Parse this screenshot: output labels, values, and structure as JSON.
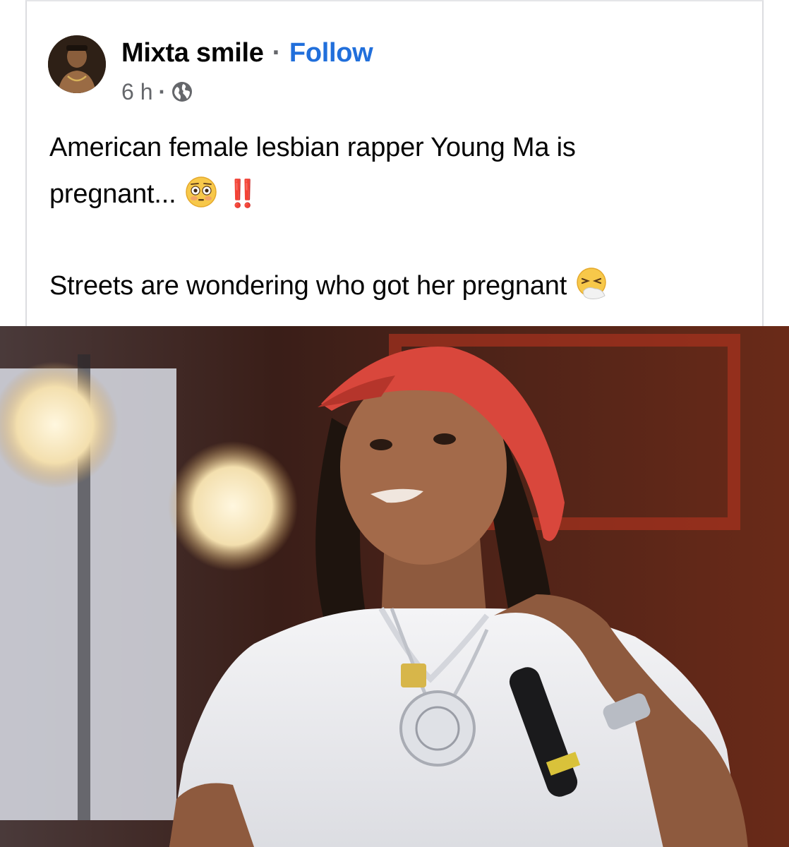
{
  "author": {
    "name": "Mixta smile",
    "separator": "·",
    "follow_label": "Follow"
  },
  "meta": {
    "time": "6 h",
    "separator": "·",
    "privacy_icon": "globe-icon"
  },
  "post": {
    "line1": "American female lesbian rapper Young Ma is",
    "line2_text": "pregnant...",
    "line2_emoji": "flushed-face-emoji",
    "line2_marks": "‼️",
    "line3_text": "Streets are wondering who got her pregnant",
    "line3_emoji": "sneezing-face-emoji"
  },
  "colors": {
    "link": "#216fdb",
    "text": "#050505",
    "secondary": "#65676b",
    "photo_cap": "#d9473c"
  }
}
